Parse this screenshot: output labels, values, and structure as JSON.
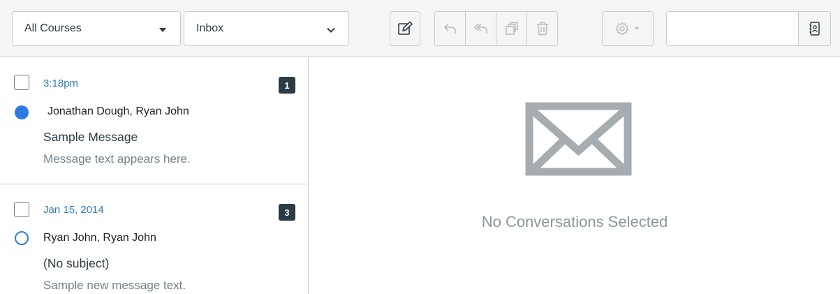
{
  "toolbar": {
    "course_filter": "All Courses",
    "mailbox_filter": "Inbox",
    "buttons": {
      "compose": "pencil-square-icon",
      "reply": "reply-icon",
      "reply_all": "reply-all-icon",
      "archive": "archive-icon",
      "delete": "trash-icon",
      "settings": "gear-icon"
    },
    "search": {
      "value": "",
      "placeholder": ""
    }
  },
  "conversations": [
    {
      "date": "3:18pm",
      "count": "1",
      "participants": "Jonathan Dough, Ryan John",
      "subject": "Sample Message",
      "preview": "Message text appears here.",
      "unread": true
    },
    {
      "date": "Jan 15, 2014",
      "count": "3",
      "participants": "Ryan John, Ryan John",
      "subject": "(No subject)",
      "preview": "Sample new message text.",
      "unread": false
    }
  ],
  "detail": {
    "empty_message": "No Conversations Selected",
    "icon": "envelope-icon"
  },
  "colors": {
    "accent": "#2b7ce0",
    "link": "#2b7abc",
    "toolbar_bg": "#f5f5f5",
    "border": "#c7cdd1"
  }
}
